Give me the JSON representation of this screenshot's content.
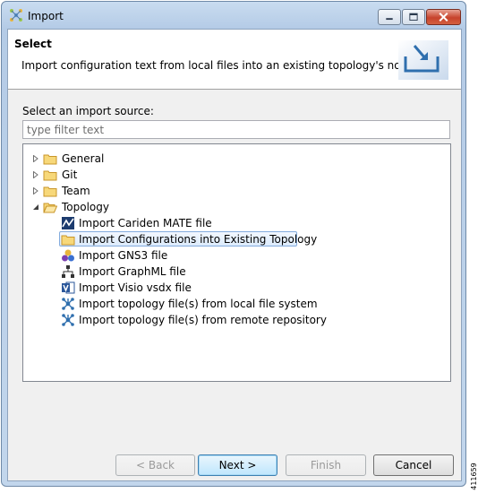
{
  "window": {
    "title": "Import",
    "minimize_label": "minimize",
    "maximize_label": "maximize",
    "close_label": "close"
  },
  "header": {
    "title": "Select",
    "description": "Import configuration text from local files into an existing topology's nodes."
  },
  "source": {
    "label": "Select an import source:",
    "filter_placeholder": "type filter text"
  },
  "tree": {
    "items": [
      {
        "label": "General",
        "icon": "folder-closed-icon",
        "expanded": false
      },
      {
        "label": "Git",
        "icon": "folder-closed-icon",
        "expanded": false
      },
      {
        "label": "Team",
        "icon": "folder-closed-icon",
        "expanded": false
      },
      {
        "label": "Topology",
        "icon": "folder-open-icon",
        "expanded": true
      },
      {
        "label": "Import Cariden MATE file",
        "icon": "cariden-mate-icon"
      },
      {
        "label": "Import Configurations into Existing Topology",
        "icon": "folder-icon",
        "selected": true
      },
      {
        "label": "Import GNS3 file",
        "icon": "gns3-icon"
      },
      {
        "label": "Import GraphML file",
        "icon": "graphml-icon"
      },
      {
        "label": "Import Visio vsdx file",
        "icon": "visio-icon"
      },
      {
        "label": "Import topology file(s) from local file system",
        "icon": "topology-icon"
      },
      {
        "label": "Import topology file(s) from remote repository",
        "icon": "topology-icon"
      }
    ]
  },
  "buttons": {
    "back": "< Back",
    "next": "Next >",
    "finish": "Finish",
    "cancel": "Cancel"
  },
  "figure_id": "411659",
  "colors": {
    "selection": "#dcebfc",
    "folder": "#e8b53c",
    "window_frame": "#b4cbe6",
    "close_button": "#c7432c"
  }
}
